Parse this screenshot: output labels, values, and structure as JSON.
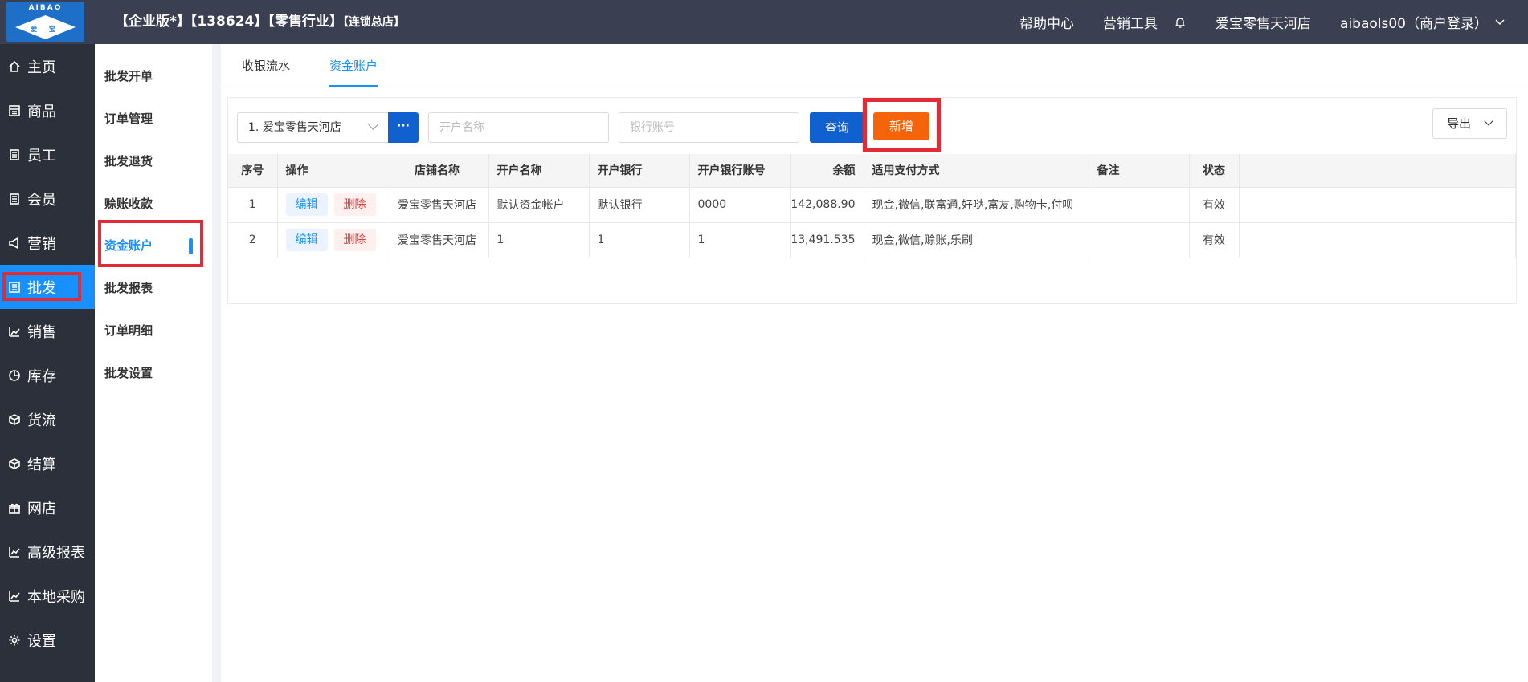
{
  "logo": {
    "top_text": "AIBAO",
    "sub_text": "爱 宝"
  },
  "header": {
    "tenant_main": "【企业版*】【138624】【零售行业】",
    "tenant_small": "【连锁总店】",
    "help": "帮助中心",
    "marketing_tools": "营销工具",
    "store": "爱宝零售天河店",
    "user": "aibaols00（商户登录）"
  },
  "sidebar": {
    "items": [
      {
        "label": "主页",
        "icon": "home-icon"
      },
      {
        "label": "商品",
        "icon": "goods-icon"
      },
      {
        "label": "员工",
        "icon": "staff-icon"
      },
      {
        "label": "会员",
        "icon": "member-icon"
      },
      {
        "label": "营销",
        "icon": "megaphone-icon"
      },
      {
        "label": "批发",
        "icon": "wholesale-icon"
      },
      {
        "label": "销售",
        "icon": "sales-chart-icon"
      },
      {
        "label": "库存",
        "icon": "pie-icon"
      },
      {
        "label": "货流",
        "icon": "cube-icon"
      },
      {
        "label": "结算",
        "icon": "settle-icon"
      },
      {
        "label": "网店",
        "icon": "gift-icon"
      },
      {
        "label": "高级报表",
        "icon": "line-chart-icon"
      },
      {
        "label": "本地采购",
        "icon": "trend-icon"
      },
      {
        "label": "设置",
        "icon": "gear-icon"
      }
    ],
    "active": "批发"
  },
  "subnav": {
    "items": [
      "批发开单",
      "订单管理",
      "批发退货",
      "赊账收款",
      "资金账户",
      "批发报表",
      "订单明细",
      "批发设置"
    ],
    "active": "资金账户"
  },
  "tabs": [
    "收银流水",
    "资金账户"
  ],
  "filters": {
    "store_select": "1. 爱宝零售天河店",
    "more": "···",
    "account_name_placeholder": "开户名称",
    "bank_account_placeholder": "银行账号",
    "query": "查询",
    "add": "新增",
    "export": "导出"
  },
  "table": {
    "headers": [
      "序号",
      "操作",
      "店铺名称",
      "开户名称",
      "开户银行",
      "开户银行账号",
      "余额",
      "适用支付方式",
      "备注",
      "状态",
      ""
    ],
    "edit_label": "编辑",
    "delete_label": "删除",
    "rows": [
      {
        "no": "1",
        "store": "爱宝零售天河店",
        "account_name": "默认资金帐户",
        "bank": "默认银行",
        "bank_account": "0000",
        "balance": "142,088.90",
        "payment": "现金,微信,联富通,好哒,富友,购物卡,付呗",
        "remark": "",
        "status": "有效"
      },
      {
        "no": "2",
        "store": "爱宝零售天河店",
        "account_name": "1",
        "bank": "1",
        "bank_account": "1",
        "balance": "13,491.535",
        "payment": "现金,微信,赊账,乐刷",
        "remark": "",
        "status": "有效"
      }
    ]
  },
  "colors": {
    "topbar": "#3a3f51",
    "sidebar": "#2b303b",
    "accent": "#1890ff",
    "primary_button": "#1060d0",
    "add_button": "#f5640a",
    "highlight": "#e32b35"
  }
}
